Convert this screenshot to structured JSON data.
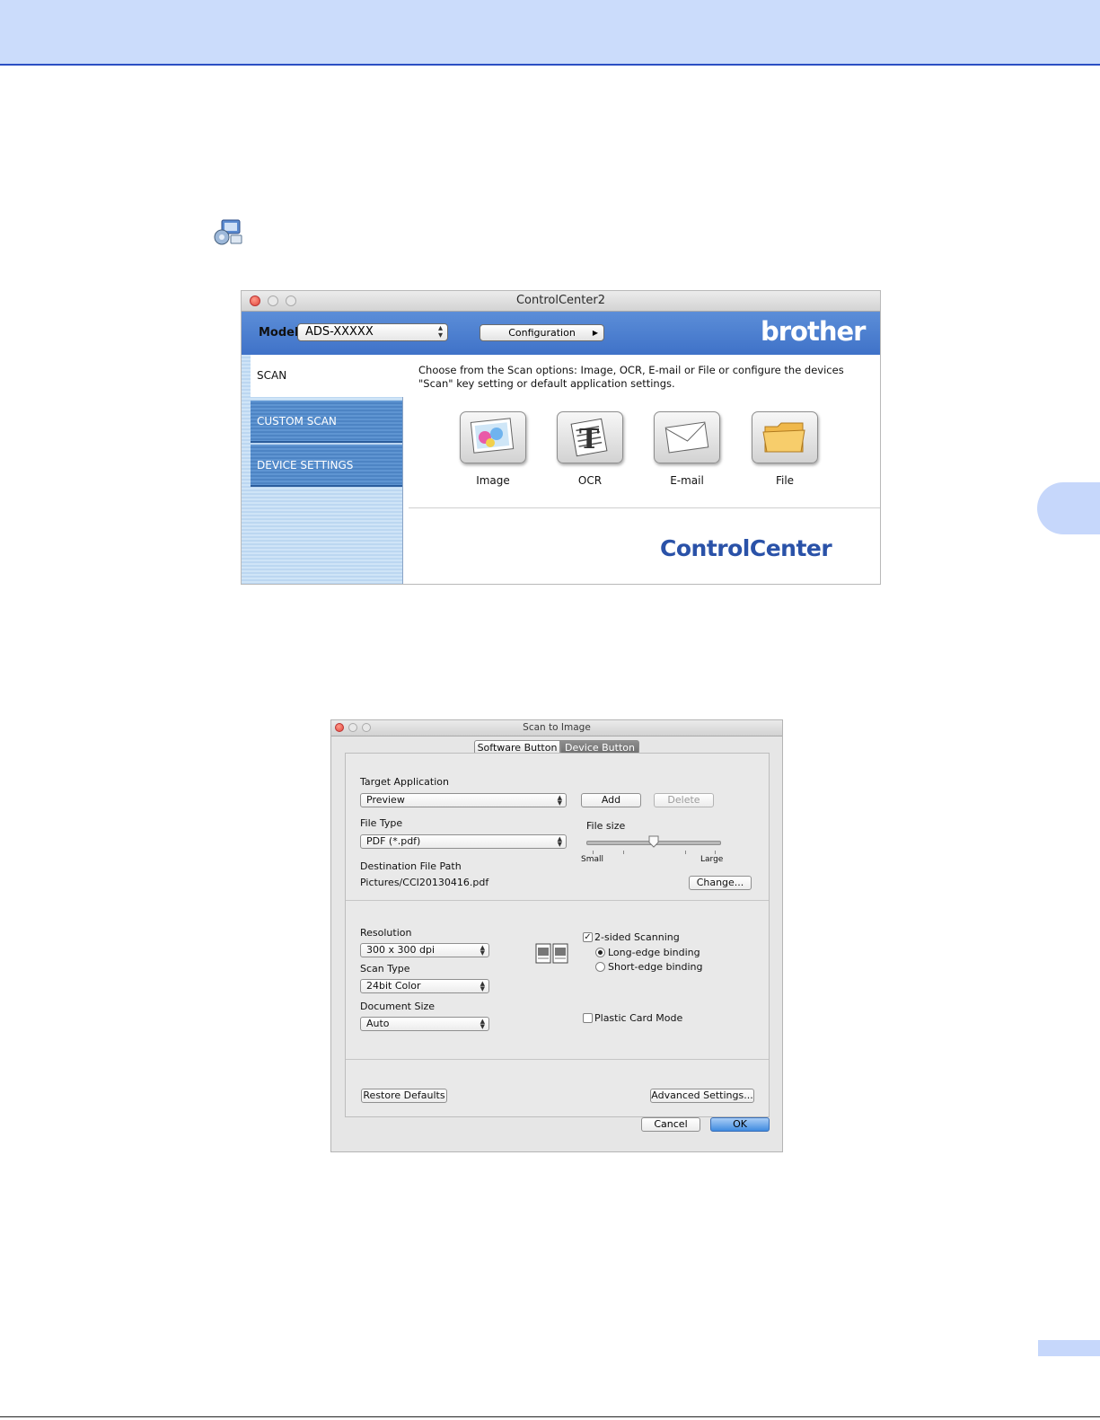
{
  "controlcenter": {
    "window_title": "ControlCenter2",
    "model_label": "Model",
    "model_value": "ADS-XXXXX",
    "configuration_label": "Configuration",
    "brand_logo": "brother",
    "sidebar": [
      {
        "label": "SCAN",
        "active": true
      },
      {
        "label": "CUSTOM SCAN",
        "active": false
      },
      {
        "label": "DEVICE SETTINGS",
        "active": false
      }
    ],
    "description_line1": "Choose from the Scan options: Image, OCR, E-mail or File or configure the devices",
    "description_line2": "\"Scan\" key setting or default application settings.",
    "scan_options": [
      {
        "label": "Image",
        "icon": "image-icon"
      },
      {
        "label": "OCR",
        "icon": "ocr-icon"
      },
      {
        "label": "E-mail",
        "icon": "email-icon"
      },
      {
        "label": "File",
        "icon": "folder-icon"
      }
    ],
    "footer_logo": "ControlCenter",
    "colors": {
      "toolbar": "#4f82cf",
      "logo_blue": "#2a52a8"
    }
  },
  "dialog": {
    "title": "Scan to Image",
    "tabs": [
      {
        "label": "Software Button",
        "selected": false
      },
      {
        "label": "Device Button",
        "selected": true
      }
    ],
    "target_application_label": "Target Application",
    "target_application_value": "Preview",
    "add_label": "Add",
    "delete_label": "Delete",
    "file_type_label": "File Type",
    "file_type_value": "PDF (*.pdf)",
    "file_size_label": "File size",
    "file_size_small": "Small",
    "file_size_large": "Large",
    "file_size_level": 0.5,
    "destination_label": "Destination File Path",
    "destination_value": "Pictures/CCI20130416.pdf",
    "change_label": "Change...",
    "resolution_label": "Resolution",
    "resolution_value": "300 x 300 dpi",
    "scan_type_label": "Scan Type",
    "scan_type_value": "24bit Color",
    "document_size_label": "Document Size",
    "document_size_value": "Auto",
    "two_sided_label": "2-sided Scanning",
    "two_sided_checked": true,
    "long_edge_label": "Long-edge binding",
    "short_edge_label": "Short-edge binding",
    "binding_selected": "long",
    "plastic_card_label": "Plastic Card Mode",
    "plastic_card_checked": false,
    "restore_defaults_label": "Restore Defaults",
    "advanced_settings_label": "Advanced Settings...",
    "cancel_label": "Cancel",
    "ok_label": "OK"
  }
}
